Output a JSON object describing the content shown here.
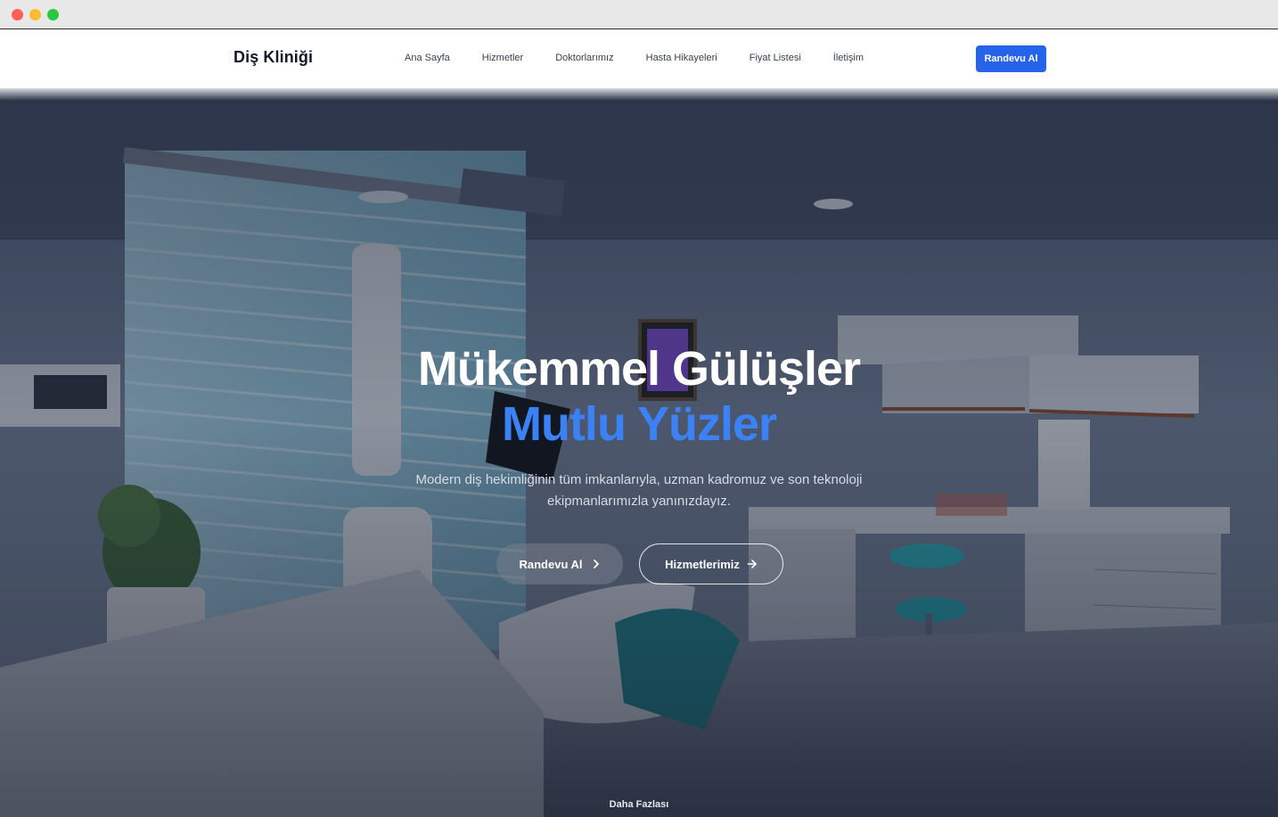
{
  "navbar": {
    "brand": "Diş Kliniği",
    "links": [
      "Ana Sayfa",
      "Hizmetler",
      "Doktorlarımız",
      "Hasta Hikayeleri",
      "Fiyat Listesi",
      "İletişim"
    ],
    "cta_label": "Randevu Al"
  },
  "hero": {
    "headline_1": "Mükemmel Gülüşler",
    "headline_2": "Mutlu Yüzler",
    "subtitle": "Modern diş hekimliğinin tüm imkanlarıyla, uzman kadromuz ve son teknoloji ekipmanlarımızla yanınızdayız.",
    "primary_button": "Randevu Al",
    "secondary_button": "Hizmetlerimiz",
    "more_label": "Daha Fazlası"
  },
  "colors": {
    "accent": "#2563eb",
    "headline_highlight": "#3b82f6"
  },
  "icons": {
    "primary_button_icon": "chevron-right-icon",
    "secondary_button_icon": "arrow-right-icon"
  }
}
